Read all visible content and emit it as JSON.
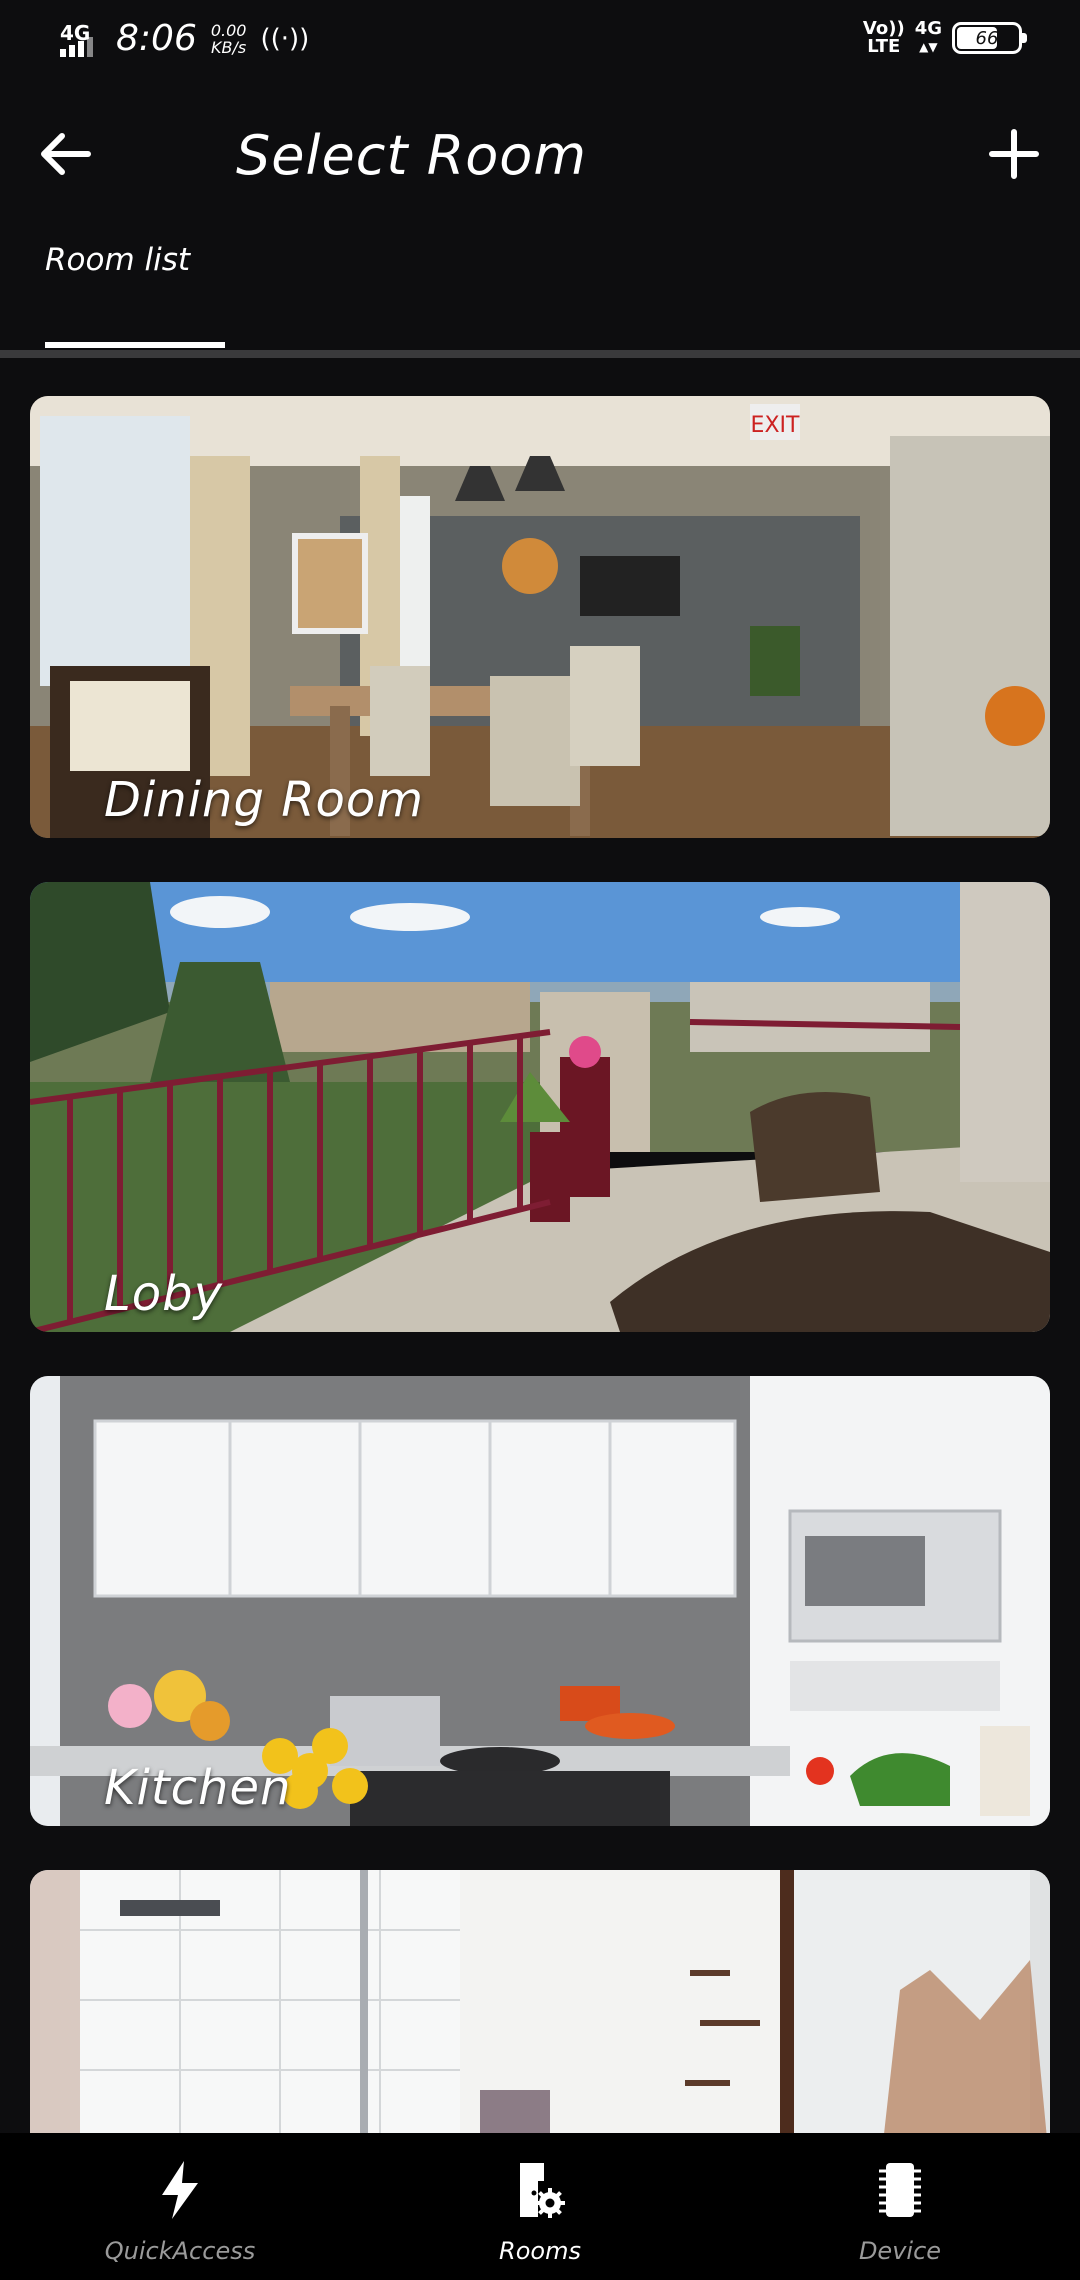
{
  "status_bar": {
    "network": "4G",
    "time": "8:06",
    "speed_value": "0.00",
    "speed_unit": "KB/s",
    "volte_top": "Vo))",
    "volte_bottom": "LTE",
    "network_right": "4G",
    "battery": "66"
  },
  "header": {
    "title": "Select Room",
    "back_icon": "back-arrow-icon",
    "add_icon": "plus-icon"
  },
  "tabs": [
    {
      "label": "Room list",
      "active": true
    }
  ],
  "rooms": [
    {
      "name": "Dining Room"
    },
    {
      "name": "Loby"
    },
    {
      "name": "Kitchen"
    },
    {
      "name": ""
    }
  ],
  "bottom_nav": [
    {
      "label": "QuickAccess",
      "icon": "lightning-icon",
      "active": false
    },
    {
      "label": "Rooms",
      "icon": "room-settings-icon",
      "active": true
    },
    {
      "label": "Device",
      "icon": "device-chip-icon",
      "active": false
    }
  ],
  "colors": {
    "background": "#0d0d0f",
    "nav_inactive": "#9a9a9a",
    "nav_active": "#ffffff"
  }
}
